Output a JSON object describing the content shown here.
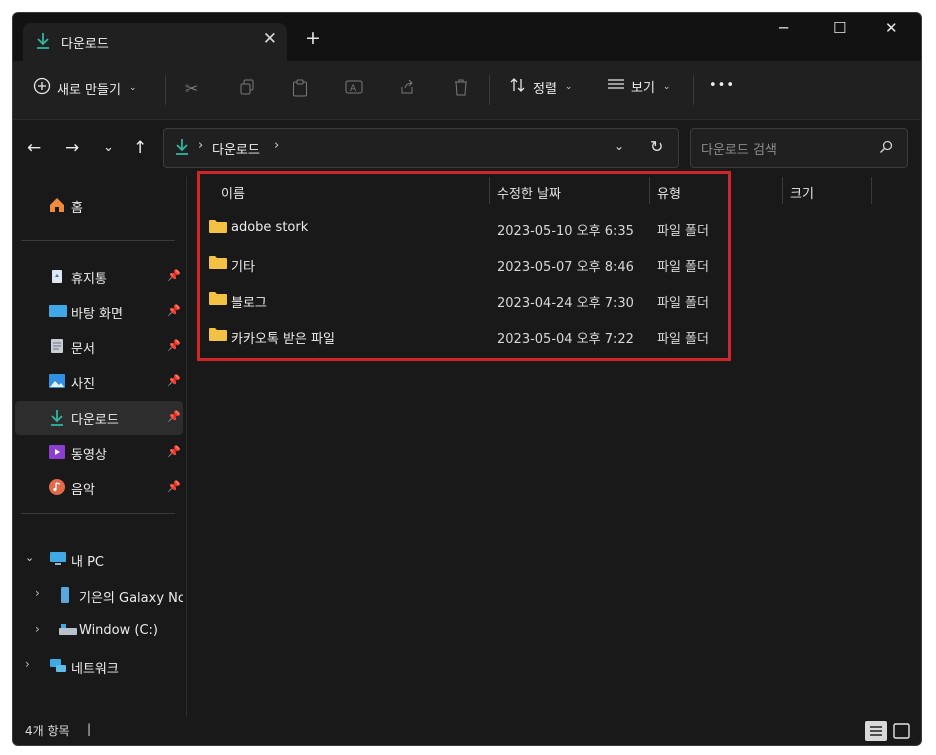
{
  "window": {
    "tab_title": "다운로드",
    "new_tab": "+",
    "controls": [
      "─",
      "☐",
      "✕"
    ]
  },
  "toolbar": {
    "new_label": "새로 만들기",
    "sort_label": "정렬",
    "view_label": "보기",
    "more": "•••"
  },
  "address": {
    "segment": "다운로드",
    "search_placeholder": "다운로드 검색"
  },
  "sidebar": {
    "home": "홈",
    "quick": [
      {
        "label": "휴지통",
        "icon": "recycle-bin-icon"
      },
      {
        "label": "바탕 화면",
        "icon": "desktop-icon"
      },
      {
        "label": "문서",
        "icon": "documents-icon"
      },
      {
        "label": "사진",
        "icon": "pictures-icon"
      },
      {
        "label": "다운로드",
        "icon": "downloads-icon"
      },
      {
        "label": "동영상",
        "icon": "videos-icon"
      },
      {
        "label": "음악",
        "icon": "music-icon"
      }
    ],
    "this_pc": "내 PC",
    "pc_children": [
      "기은의 Galaxy Nc",
      "Window (C:)"
    ],
    "network": "네트워크"
  },
  "columns": {
    "name": "이름",
    "date": "수정한 날짜",
    "type": "유형",
    "size": "크기"
  },
  "files": [
    {
      "name": "adobe stork",
      "date": "2023-05-10 오후 6:35",
      "type": "파일 폴더"
    },
    {
      "name": "기타",
      "date": "2023-05-07 오후 8:46",
      "type": "파일 폴더"
    },
    {
      "name": "블로그",
      "date": "2023-04-24 오후 7:30",
      "type": "파일 폴더"
    },
    {
      "name": "카카오톡 받은 파일",
      "date": "2023-05-04 오후 7:22",
      "type": "파일 폴더"
    }
  ],
  "status": {
    "count": "4개 항목",
    "cursor": "|"
  },
  "colors": {
    "accent_download": "#2fb5a0",
    "folder": "#f3c244",
    "highlight": "#d0262a"
  }
}
